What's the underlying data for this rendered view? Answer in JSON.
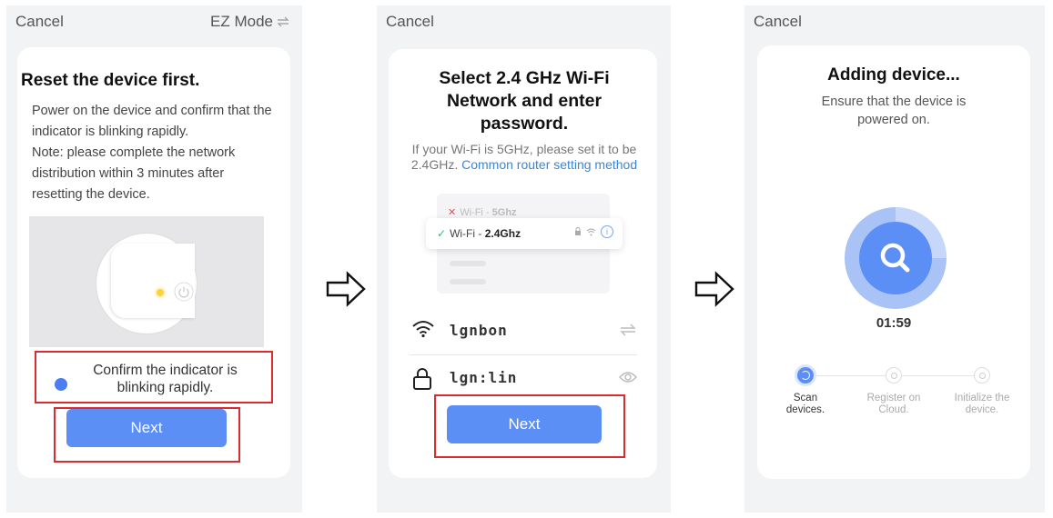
{
  "screen1": {
    "cancel": "Cancel",
    "mode": "EZ Mode",
    "title": "Reset the device first.",
    "body": "Power on the device and confirm that the indicator is blinking rapidly.\nNote: please complete the network distribution within 3 minutes after resetting the device.",
    "confirm": "Confirm the indicator is blinking rapidly.",
    "next": "Next"
  },
  "screen2": {
    "cancel": "Cancel",
    "title": "Select 2.4 GHz Wi-Fi Network and enter password.",
    "hint": "If your Wi-Fi is 5GHz, please set it to be 2.4GHz.",
    "link": "Common router setting method",
    "wifi_5g_prefix": "Wi-Fi - ",
    "wifi_5g_band": "5Ghz",
    "wifi_24_prefix": "Wi-Fi - ",
    "wifi_24_band": "2.4Ghz",
    "ssid": "lgnbon",
    "password": "lgn:lin",
    "next": "Next"
  },
  "screen3": {
    "cancel": "Cancel",
    "title": "Adding device...",
    "body": "Ensure that the device is powered on.",
    "timer": "01:59",
    "steps": [
      {
        "label": "Scan devices.",
        "active": true
      },
      {
        "label": "Register on Cloud.",
        "active": false
      },
      {
        "label": "Initialize the device.",
        "active": false
      }
    ]
  },
  "colors": {
    "accent": "#5b8ff5",
    "highlight_box": "#d82c30",
    "link": "#3a86d8",
    "led": "#ffd23c"
  },
  "icons": [
    "arrow-right-icon",
    "switch-mode-icon",
    "power-icon",
    "wifi-icon",
    "lock-icon",
    "eye-icon",
    "search-icon",
    "check-icon",
    "close-icon",
    "info-icon"
  ]
}
